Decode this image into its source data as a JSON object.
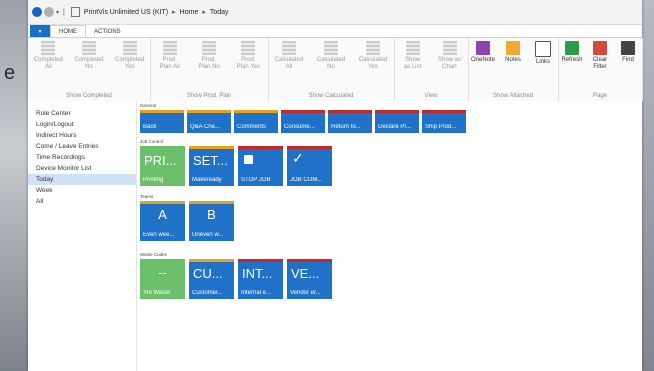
{
  "window": {
    "breadcrumb": [
      "PrintVis Unlimited US (KIT)",
      "Home",
      "Today"
    ],
    "sep": "▸"
  },
  "tabs": [
    "HOME",
    "ACTIONS"
  ],
  "ribbon": {
    "groups": [
      {
        "label": "Show Completed",
        "buttons": [
          [
            "Completed",
            "All"
          ],
          [
            "Completed",
            "No"
          ],
          [
            "Completed",
            "Yes"
          ]
        ]
      },
      {
        "label": "Show Prod. Plan",
        "buttons": [
          [
            "Prod.",
            "Plan  All"
          ],
          [
            "Prod.",
            "Plan  No"
          ],
          [
            "Prod.",
            "Plan  Yes"
          ]
        ]
      },
      {
        "label": "Show Calculated",
        "buttons": [
          [
            "Calculated",
            "All"
          ],
          [
            "Calculated",
            "No"
          ],
          [
            "Calculated",
            "Yes"
          ]
        ]
      },
      {
        "label": "View",
        "buttons": [
          [
            "Show",
            "as List"
          ],
          [
            "Show as",
            "Chart"
          ]
        ]
      },
      {
        "label": "Show Attached",
        "buttons": [
          [
            "OneNote"
          ],
          [
            "Notes"
          ],
          [
            "Links"
          ]
        ]
      },
      {
        "label": "Page",
        "buttons": [
          [
            "Refresh"
          ],
          [
            "Clear",
            "Filter"
          ],
          [
            "Find"
          ]
        ]
      }
    ]
  },
  "sidebar": {
    "items": [
      "Role Center",
      "Login/Logout",
      "Indirect Hours",
      "Come / Leave   Entries",
      "Time Recordings",
      "Device Monitor List",
      "Today",
      "Week",
      "All"
    ],
    "active": "Today"
  },
  "sections": [
    {
      "label": "General",
      "tiles": [
        {
          "label": "Back",
          "bar": "#e6a21a"
        },
        {
          "label": "Q&A Che...",
          "bar": "#e6a21a"
        },
        {
          "label": "Comments",
          "bar": "#e6a21a"
        },
        {
          "label": "Consume...",
          "bar": "#c62828"
        },
        {
          "label": "Return to...",
          "bar": "#c62828"
        },
        {
          "label": "Declare Pr...",
          "bar": "#c62828"
        },
        {
          "label": "Ship Prod...",
          "bar": "#c62828"
        }
      ]
    },
    {
      "label": "Job Control",
      "tiles": [
        {
          "big": "PRI...",
          "label": "Printing",
          "bg": "#6cc06c",
          "bar": "#6cc06c"
        },
        {
          "big": "SET...",
          "label": "Makeready",
          "bg": "#1f72c8",
          "bar": "#e6a21a"
        },
        {
          "icon": "stop-icon",
          "label": "STOP JOB",
          "bg": "#1f72c8",
          "bar": "#c62828"
        },
        {
          "icon": "check-icon",
          "label": "JOB COM...",
          "bg": "#1f72c8",
          "bar": "#c62828"
        }
      ]
    },
    {
      "label": "Teams",
      "tiles": [
        {
          "big": "A",
          "label": "Even wee...",
          "bar": "#e6a21a"
        },
        {
          "big": "B",
          "label": "Uneven w...",
          "bar": "#e6a21a"
        }
      ]
    },
    {
      "label": "Waste Codes",
      "tiles": [
        {
          "big": "--",
          "label": "'No Waste'",
          "bg": "#6cc06c",
          "bar": "#6cc06c"
        },
        {
          "big": "CU...",
          "label": "Customer...",
          "bg": "#1f72c8",
          "bar": "#e6a21a"
        },
        {
          "big": "INT...",
          "label": "Internal e...",
          "bg": "#1f72c8",
          "bar": "#c62828"
        },
        {
          "big": "VE...",
          "label": "Vendor er...",
          "bg": "#1f72c8",
          "bar": "#c62828"
        }
      ]
    }
  ],
  "bg_letter": "e"
}
